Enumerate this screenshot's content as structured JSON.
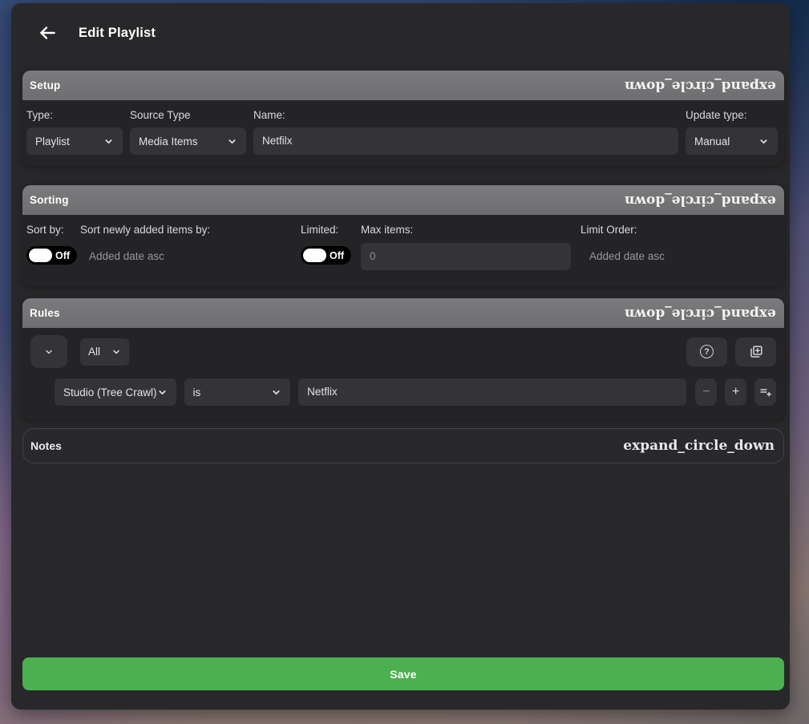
{
  "window": {
    "title": "Edit Playlist"
  },
  "icons": {
    "expand_fallback_text": "expand_circle_down",
    "help_glyph": "?",
    "minus_glyph": "−",
    "plus_glyph": "+"
  },
  "setup": {
    "title": "Setup",
    "type_label": "Type:",
    "type_value": "Playlist",
    "source_label": "Source Type",
    "source_value": "Media Items",
    "name_label": "Name:",
    "name_value": "Netfilx",
    "update_label": "Update type:",
    "update_value": "Manual"
  },
  "sorting": {
    "title": "Sorting",
    "sort_by_label": "Sort by:",
    "sort_by_toggle": "Off",
    "newly_label": "Sort newly added items by:",
    "newly_value": "Added date asc",
    "limited_label": "Limited:",
    "limited_toggle": "Off",
    "max_items_label": "Max items:",
    "max_items_placeholder": "0",
    "limit_order_label": "Limit Order:",
    "limit_order_value": "Added date asc"
  },
  "rules": {
    "title": "Rules",
    "match_value": "All",
    "rule_field": "Studio (Tree Crawl)",
    "rule_operator": "is",
    "rule_value": "Netflix"
  },
  "notes": {
    "title": "Notes"
  },
  "save_label": "Save",
  "colors": {
    "accent_green": "#4caf50",
    "section_header_gray": "#737375",
    "panel_bg": "#28282a",
    "control_bg": "#343437",
    "toggle_bg": "#000000"
  }
}
